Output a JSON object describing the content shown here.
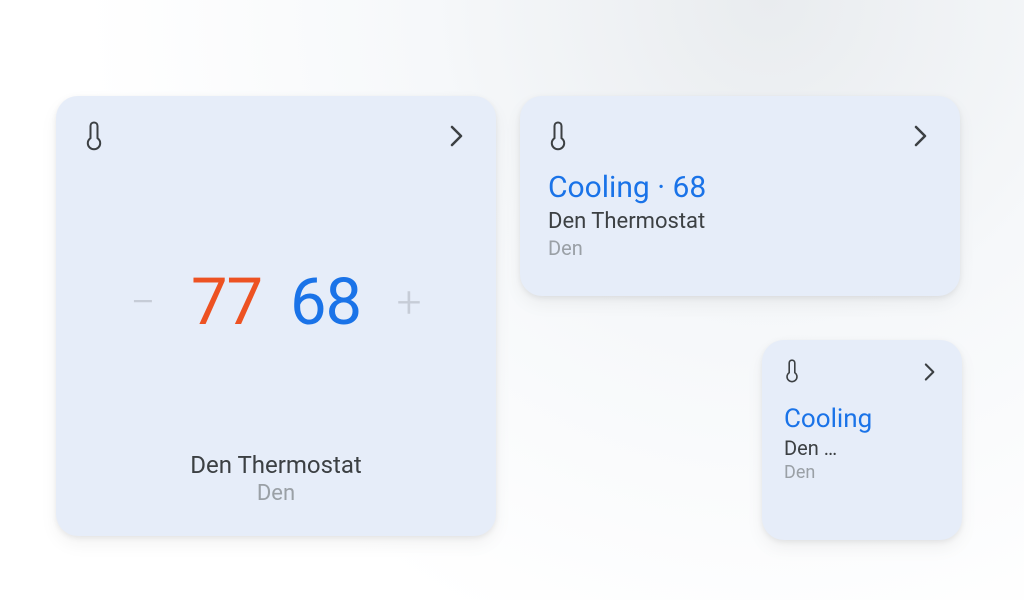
{
  "large_card": {
    "heat_setpoint": "77",
    "cool_setpoint": "68",
    "device_name": "Den Thermostat",
    "room": "Den",
    "minus_glyph": "−",
    "plus_glyph": "+"
  },
  "medium_card": {
    "status_line": "Cooling · 68",
    "device_name": "Den Thermostat",
    "room": "Den"
  },
  "small_card": {
    "status_line": "Cooling",
    "device_name": "Den …",
    "room": "Den"
  }
}
